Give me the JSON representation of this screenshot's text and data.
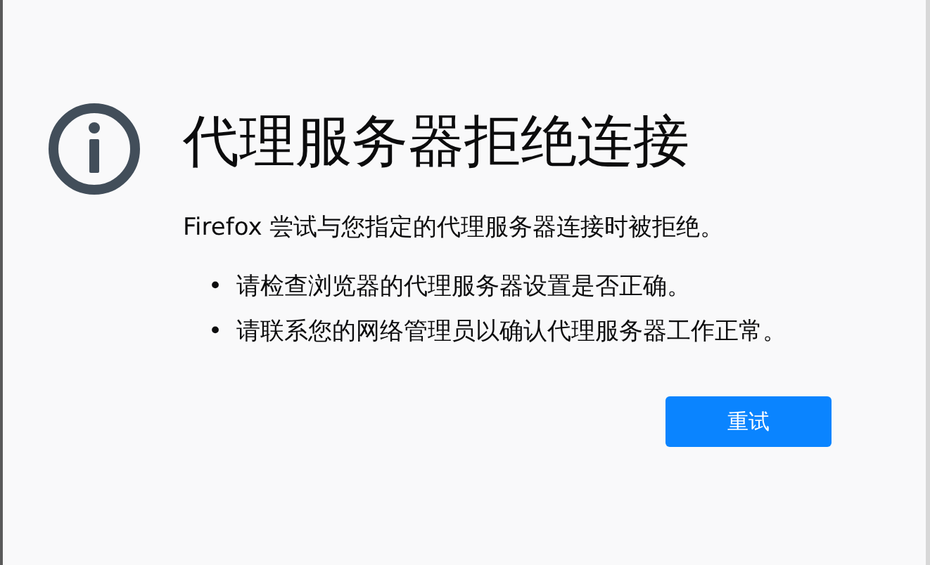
{
  "title": "代理服务器拒绝连接",
  "description": "Firefox 尝试与您指定的代理服务器连接时被拒绝。",
  "suggestions": [
    {
      "bullet": "•",
      "text": "请检查浏览器的代理服务器设置是否正确。"
    },
    {
      "bullet": "•",
      "text": "请联系您的网络管理员以确认代理服务器工作正常。"
    }
  ],
  "button": "重试"
}
